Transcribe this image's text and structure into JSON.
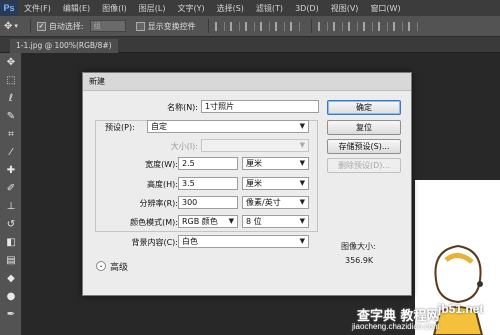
{
  "app": {
    "logo": "Ps"
  },
  "menu": [
    "文件(F)",
    "编辑(E)",
    "图像(I)",
    "图层(L)",
    "文字(Y)",
    "选择(S)",
    "滤镜(T)",
    "3D(D)",
    "视图(V)",
    "窗口(W)"
  ],
  "options_bar": {
    "auto_select_label": "自动选择:",
    "auto_select_value": "组",
    "show_transform_label": "显示变换控件"
  },
  "doc_tab": {
    "title": "1-1.jpg @ 100%(RGB/8#)"
  },
  "dialog": {
    "title": "新建",
    "name_label": "名称(N):",
    "name_value": "1寸照片",
    "preset_label": "预设(P):",
    "preset_value": "自定",
    "size_label": "大小(I):",
    "size_value": "",
    "width_label": "宽度(W):",
    "width_value": "2.5",
    "width_unit": "厘米",
    "height_label": "高度(H):",
    "height_value": "3.5",
    "height_unit": "厘米",
    "resolution_label": "分辨率(R):",
    "resolution_value": "300",
    "resolution_unit": "像素/英寸",
    "color_mode_label": "颜色模式(M):",
    "color_mode_value": "RGB 颜色",
    "bit_depth_value": "8 位",
    "background_label": "背景内容(C):",
    "background_value": "白色",
    "advanced_label": "高级",
    "image_size_label": "图像大小:",
    "image_size_value": "356.9K",
    "buttons": {
      "ok": "确定",
      "reset": "复位",
      "save_preset": "存储预设(S)...",
      "delete_preset": "删除预设(D)..."
    }
  },
  "watermark": {
    "site": "jb51.net",
    "cn": "查字典 教程网",
    "url": "jiaocheng.chazidian.com"
  }
}
